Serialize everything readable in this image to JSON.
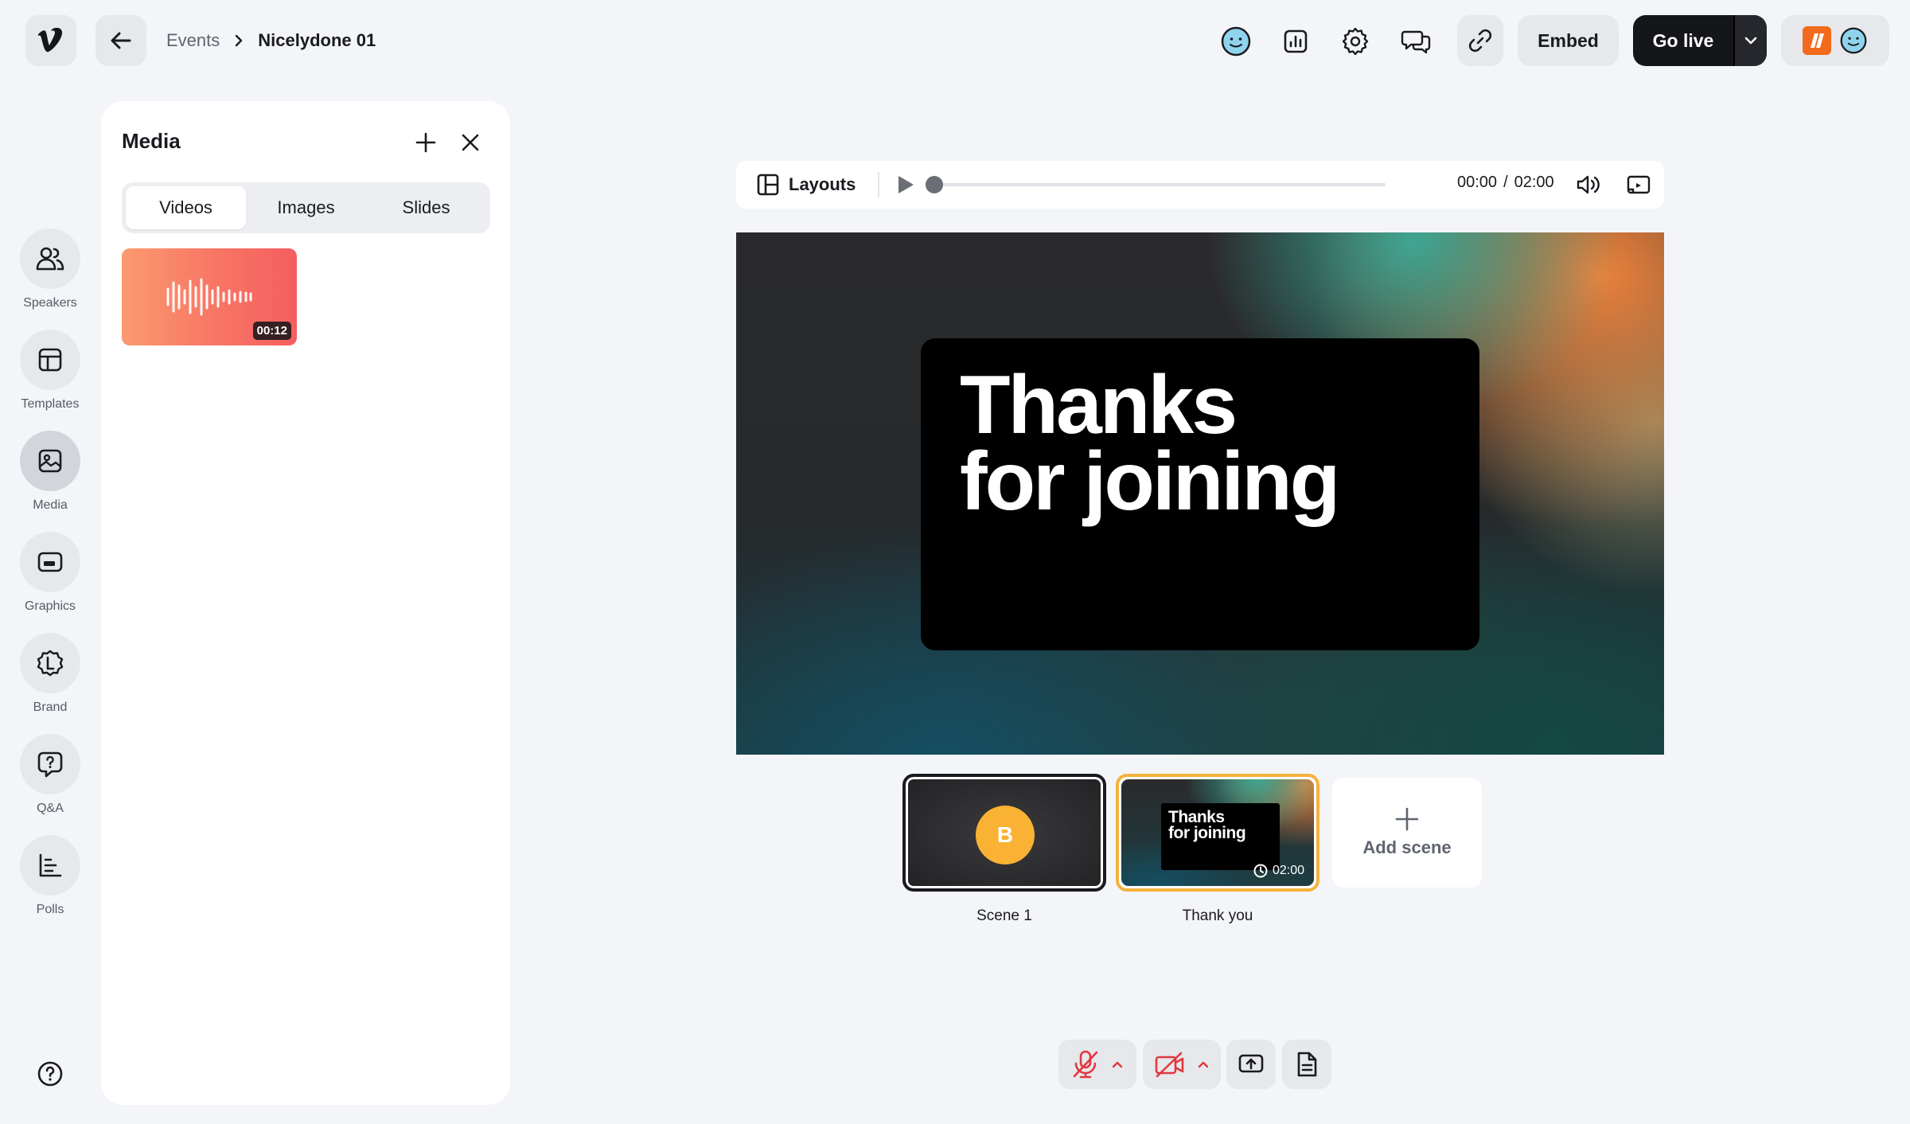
{
  "header": {
    "logo_icon": "vimeo-logo",
    "back_icon": "arrow-left-icon",
    "breadcrumb": {
      "parent": "Events",
      "separator_icon": "chevron-right-icon",
      "current": "Nicelydone 01"
    },
    "toolbar_icons": [
      "emoji-icon",
      "analytics-icon",
      "settings-icon",
      "chat-icon",
      "link-icon"
    ],
    "embed_label": "Embed",
    "golive_label": "Go live"
  },
  "sidebar": {
    "items": [
      {
        "label": "Speakers",
        "icon": "speakers-icon"
      },
      {
        "label": "Templates",
        "icon": "templates-icon"
      },
      {
        "label": "Media",
        "icon": "image-icon",
        "active": true
      },
      {
        "label": "Graphics",
        "icon": "graphics-icon"
      },
      {
        "label": "Brand",
        "icon": "brand-icon"
      },
      {
        "label": "Q&A",
        "icon": "qa-icon"
      },
      {
        "label": "Polls",
        "icon": "polls-icon"
      }
    ],
    "help_icon": "help-icon"
  },
  "media_panel": {
    "title": "Media",
    "tabs": [
      {
        "label": "Videos",
        "active": true
      },
      {
        "label": "Images"
      },
      {
        "label": "Slides"
      }
    ],
    "videos": [
      {
        "duration": "00:12",
        "icon": "audio-waveform-icon"
      }
    ]
  },
  "player": {
    "layouts_label": "Layouts",
    "current_time": "00:00",
    "separator": "/",
    "total_time": "02:00",
    "progress": 0
  },
  "stage": {
    "line1": "Thanks",
    "line2": "for joining"
  },
  "scenes": [
    {
      "label": "Scene 1",
      "avatar_initial": "B"
    },
    {
      "label": "Thank you",
      "line1": "Thanks",
      "line2": "for joining",
      "duration": "02:00"
    }
  ],
  "add_scene_label": "Add scene",
  "colors": {
    "accent_orange": "#f5b23c",
    "go_live_bg": "#15161a",
    "avatar_yellow": "#f9b233",
    "muted_red": "#e0383e"
  }
}
